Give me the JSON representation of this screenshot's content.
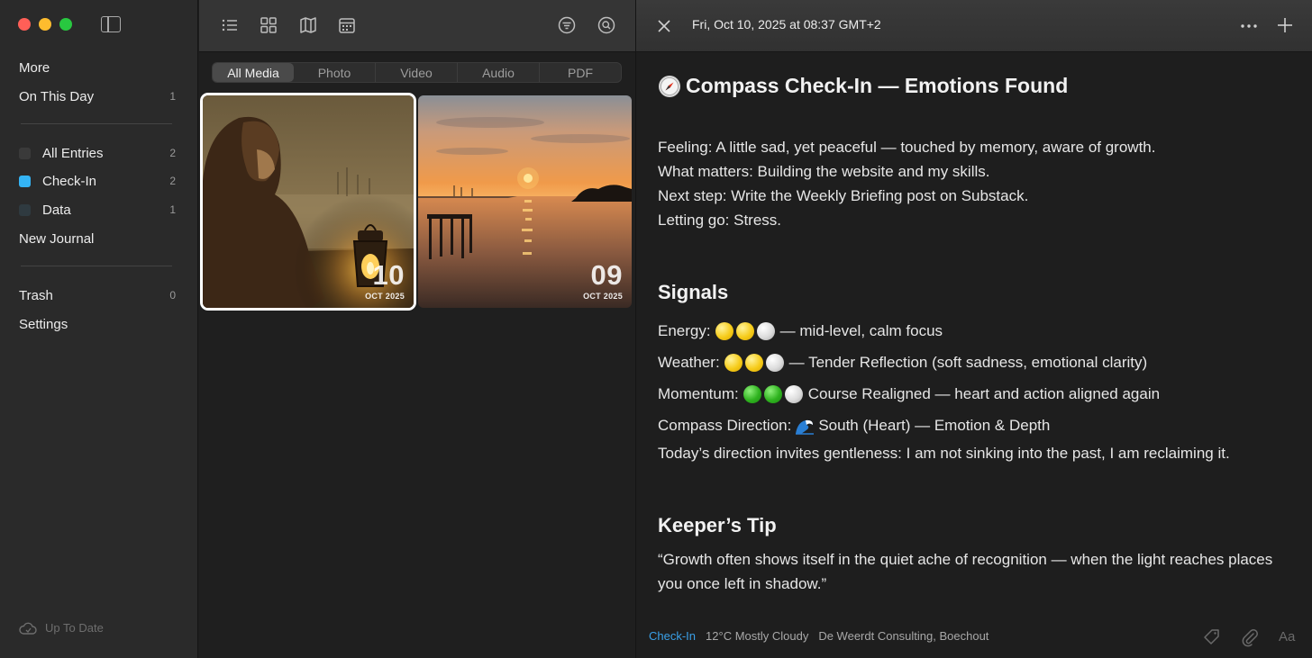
{
  "sidebar": {
    "items": [
      {
        "label": "More",
        "count": ""
      },
      {
        "label": "On This Day",
        "count": "1"
      },
      {
        "label": "All Entries",
        "count": "2",
        "color": "#3a3a3a"
      },
      {
        "label": "Check-In",
        "count": "2",
        "color": "#34b4f5"
      },
      {
        "label": "Data",
        "count": "1",
        "color": "#2f3a40"
      },
      {
        "label": "New Journal",
        "count": ""
      },
      {
        "label": "Trash",
        "count": "0"
      },
      {
        "label": "Settings",
        "count": ""
      }
    ],
    "sync_status": "Up To Date"
  },
  "media": {
    "filters": [
      "All Media",
      "Photo",
      "Video",
      "Audio",
      "PDF"
    ],
    "active_filter": "All Media",
    "thumbnails": [
      {
        "day": "10",
        "month": "OCT 2025",
        "selected": true
      },
      {
        "day": "09",
        "month": "OCT 2025",
        "selected": false
      }
    ]
  },
  "entry": {
    "date": "Fri, Oct 10, 2025 at 08:37 GMT+2",
    "title": "Compass Check-In — Emotions Found",
    "intro": [
      "Feeling: A little sad, yet peaceful — touched by memory, aware of growth.",
      "What matters: Building the website and my skills.",
      "Next step: Write the Weekly Briefing post on Substack.",
      "Letting go: Stress."
    ],
    "signals_heading": "Signals",
    "signals": {
      "energy_label": "Energy:",
      "energy_text": "— mid-level, calm focus",
      "weather_label": "Weather:",
      "weather_text": "— Tender Reflection (soft sadness, emotional clarity)",
      "momentum_label": "Momentum:",
      "momentum_text": "Course Realigned — heart and action aligned again",
      "direction_label": "Compass Direction:",
      "direction_text": "South (Heart)  — Emotion & Depth",
      "direction_note": "Today’s direction invites gentleness: I am not sinking into the past, I am reclaiming it."
    },
    "tip_heading": "Keeper’s Tip",
    "tip_line1": "“Growth often shows itself in the quiet ache of recognition — when the light reaches places",
    "tip_line2": "you once left in shadow.”",
    "footer": {
      "tag": "Check-In",
      "weather": "12°C Mostly Cloudy",
      "location": "De Weerdt Consulting, Boechout",
      "format_label": "Aa"
    }
  }
}
